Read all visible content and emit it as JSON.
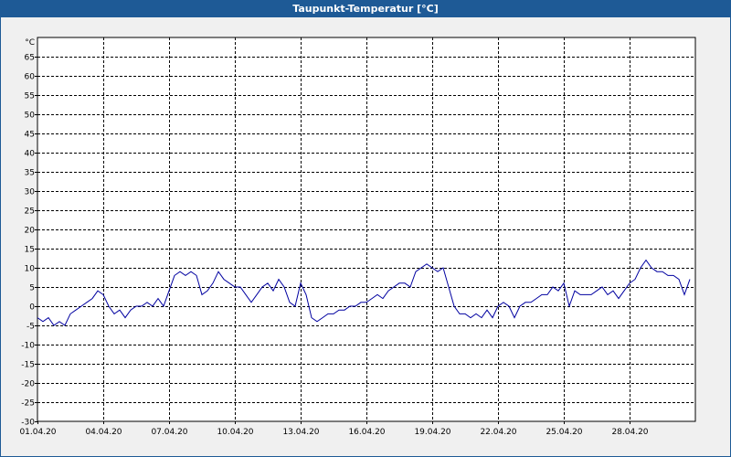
{
  "window": {
    "title": "Taupunkt-Temperatur [°C]"
  },
  "colors": {
    "line": "#0000a0",
    "grid": "#000000",
    "plot_bg": "#ffffff",
    "title_bg": "#1e5a96"
  },
  "chart_data": {
    "type": "line",
    "title": "Taupunkt-Temperatur [°C]",
    "ylabel": "°C",
    "ylim": [
      -30,
      70
    ],
    "yticks": [
      65,
      60,
      55,
      50,
      45,
      40,
      35,
      30,
      25,
      20,
      15,
      10,
      5,
      0,
      -5,
      -10,
      -15,
      -20,
      -25,
      -30
    ],
    "xlim": [
      "01.04.20",
      "01.05.20"
    ],
    "xticks": [
      "01.04.20",
      "04.04.20",
      "07.04.20",
      "10.04.20",
      "13.04.20",
      "16.04.20",
      "19.04.20",
      "22.04.20",
      "25.04.20",
      "28.04.20"
    ],
    "grid": true,
    "series": [
      {
        "points": [
          [
            "01.04.20 00:00",
            -3
          ],
          [
            "01.04.20 06:00",
            -4
          ],
          [
            "01.04.20 12:00",
            -3
          ],
          [
            "01.04.20 18:00",
            -5
          ],
          [
            "02.04.20 00:00",
            -4
          ],
          [
            "02.04.20 06:00",
            -5
          ],
          [
            "02.04.20 12:00",
            -2
          ],
          [
            "02.04.20 18:00",
            -1
          ],
          [
            "03.04.20 00:00",
            0
          ],
          [
            "03.04.20 06:00",
            1
          ],
          [
            "03.04.20 12:00",
            2
          ],
          [
            "03.04.20 18:00",
            4
          ],
          [
            "04.04.20 00:00",
            3
          ],
          [
            "04.04.20 06:00",
            0
          ],
          [
            "04.04.20 12:00",
            -2
          ],
          [
            "04.04.20 18:00",
            -1
          ],
          [
            "05.04.20 00:00",
            -3
          ],
          [
            "05.04.20 06:00",
            -1
          ],
          [
            "05.04.20 12:00",
            0
          ],
          [
            "05.04.20 18:00",
            0
          ],
          [
            "06.04.20 00:00",
            1
          ],
          [
            "06.04.20 06:00",
            0
          ],
          [
            "06.04.20 12:00",
            2
          ],
          [
            "06.04.20 18:00",
            0
          ],
          [
            "07.04.20 00:00",
            4
          ],
          [
            "07.04.20 06:00",
            8
          ],
          [
            "07.04.20 12:00",
            9
          ],
          [
            "07.04.20 18:00",
            8
          ],
          [
            "08.04.20 00:00",
            9
          ],
          [
            "08.04.20 06:00",
            8
          ],
          [
            "08.04.20 12:00",
            3
          ],
          [
            "08.04.20 18:00",
            4
          ],
          [
            "09.04.20 00:00",
            6
          ],
          [
            "09.04.20 06:00",
            9
          ],
          [
            "09.04.20 12:00",
            7
          ],
          [
            "09.04.20 18:00",
            6
          ],
          [
            "10.04.20 00:00",
            5
          ],
          [
            "10.04.20 06:00",
            5
          ],
          [
            "10.04.20 12:00",
            3
          ],
          [
            "10.04.20 18:00",
            1
          ],
          [
            "11.04.20 00:00",
            3
          ],
          [
            "11.04.20 06:00",
            5
          ],
          [
            "11.04.20 12:00",
            6
          ],
          [
            "11.04.20 18:00",
            4
          ],
          [
            "12.04.20 00:00",
            7
          ],
          [
            "12.04.20 06:00",
            5
          ],
          [
            "12.04.20 12:00",
            1
          ],
          [
            "12.04.20 18:00",
            0
          ],
          [
            "13.04.20 00:00",
            6
          ],
          [
            "13.04.20 06:00",
            3
          ],
          [
            "13.04.20 12:00",
            -3
          ],
          [
            "13.04.20 18:00",
            -4
          ],
          [
            "14.04.20 00:00",
            -3
          ],
          [
            "14.04.20 06:00",
            -2
          ],
          [
            "14.04.20 12:00",
            -2
          ],
          [
            "14.04.20 18:00",
            -1
          ],
          [
            "15.04.20 00:00",
            -1
          ],
          [
            "15.04.20 06:00",
            0
          ],
          [
            "15.04.20 12:00",
            0
          ],
          [
            "15.04.20 18:00",
            1
          ],
          [
            "16.04.20 00:00",
            1
          ],
          [
            "16.04.20 06:00",
            2
          ],
          [
            "16.04.20 12:00",
            3
          ],
          [
            "16.04.20 18:00",
            2
          ],
          [
            "17.04.20 00:00",
            4
          ],
          [
            "17.04.20 06:00",
            5
          ],
          [
            "17.04.20 12:00",
            6
          ],
          [
            "17.04.20 18:00",
            6
          ],
          [
            "18.04.20 00:00",
            5
          ],
          [
            "18.04.20 06:00",
            9
          ],
          [
            "18.04.20 12:00",
            10
          ],
          [
            "18.04.20 18:00",
            11
          ],
          [
            "19.04.20 00:00",
            10
          ],
          [
            "19.04.20 06:00",
            9
          ],
          [
            "19.04.20 12:00",
            10
          ],
          [
            "19.04.20 18:00",
            5
          ],
          [
            "20.04.20 00:00",
            0
          ],
          [
            "20.04.20 06:00",
            -2
          ],
          [
            "20.04.20 12:00",
            -2
          ],
          [
            "20.04.20 18:00",
            -3
          ],
          [
            "21.04.20 00:00",
            -2
          ],
          [
            "21.04.20 06:00",
            -3
          ],
          [
            "21.04.20 12:00",
            -1
          ],
          [
            "21.04.20 18:00",
            -3
          ],
          [
            "22.04.20 00:00",
            0
          ],
          [
            "22.04.20 06:00",
            1
          ],
          [
            "22.04.20 12:00",
            0
          ],
          [
            "22.04.20 18:00",
            -3
          ],
          [
            "23.04.20 00:00",
            0
          ],
          [
            "23.04.20 06:00",
            1
          ],
          [
            "23.04.20 12:00",
            1
          ],
          [
            "23.04.20 18:00",
            2
          ],
          [
            "24.04.20 00:00",
            3
          ],
          [
            "24.04.20 06:00",
            3
          ],
          [
            "24.04.20 12:00",
            5
          ],
          [
            "24.04.20 18:00",
            4
          ],
          [
            "25.04.20 00:00",
            6
          ],
          [
            "25.04.20 06:00",
            0
          ],
          [
            "25.04.20 12:00",
            4
          ],
          [
            "25.04.20 18:00",
            3
          ],
          [
            "26.04.20 00:00",
            3
          ],
          [
            "26.04.20 06:00",
            3
          ],
          [
            "26.04.20 12:00",
            4
          ],
          [
            "26.04.20 18:00",
            5
          ],
          [
            "27.04.20 00:00",
            3
          ],
          [
            "27.04.20 06:00",
            4
          ],
          [
            "27.04.20 12:00",
            2
          ],
          [
            "27.04.20 18:00",
            4
          ],
          [
            "28.04.20 00:00",
            6
          ],
          [
            "28.04.20 06:00",
            7
          ],
          [
            "28.04.20 12:00",
            10
          ],
          [
            "28.04.20 18:00",
            12
          ],
          [
            "29.04.20 00:00",
            10
          ],
          [
            "29.04.20 06:00",
            9
          ],
          [
            "29.04.20 12:00",
            9
          ],
          [
            "29.04.20 18:00",
            8
          ],
          [
            "30.04.20 00:00",
            8
          ],
          [
            "30.04.20 06:00",
            7
          ],
          [
            "30.04.20 12:00",
            3
          ],
          [
            "30.04.20 18:00",
            7
          ]
        ]
      }
    ]
  }
}
